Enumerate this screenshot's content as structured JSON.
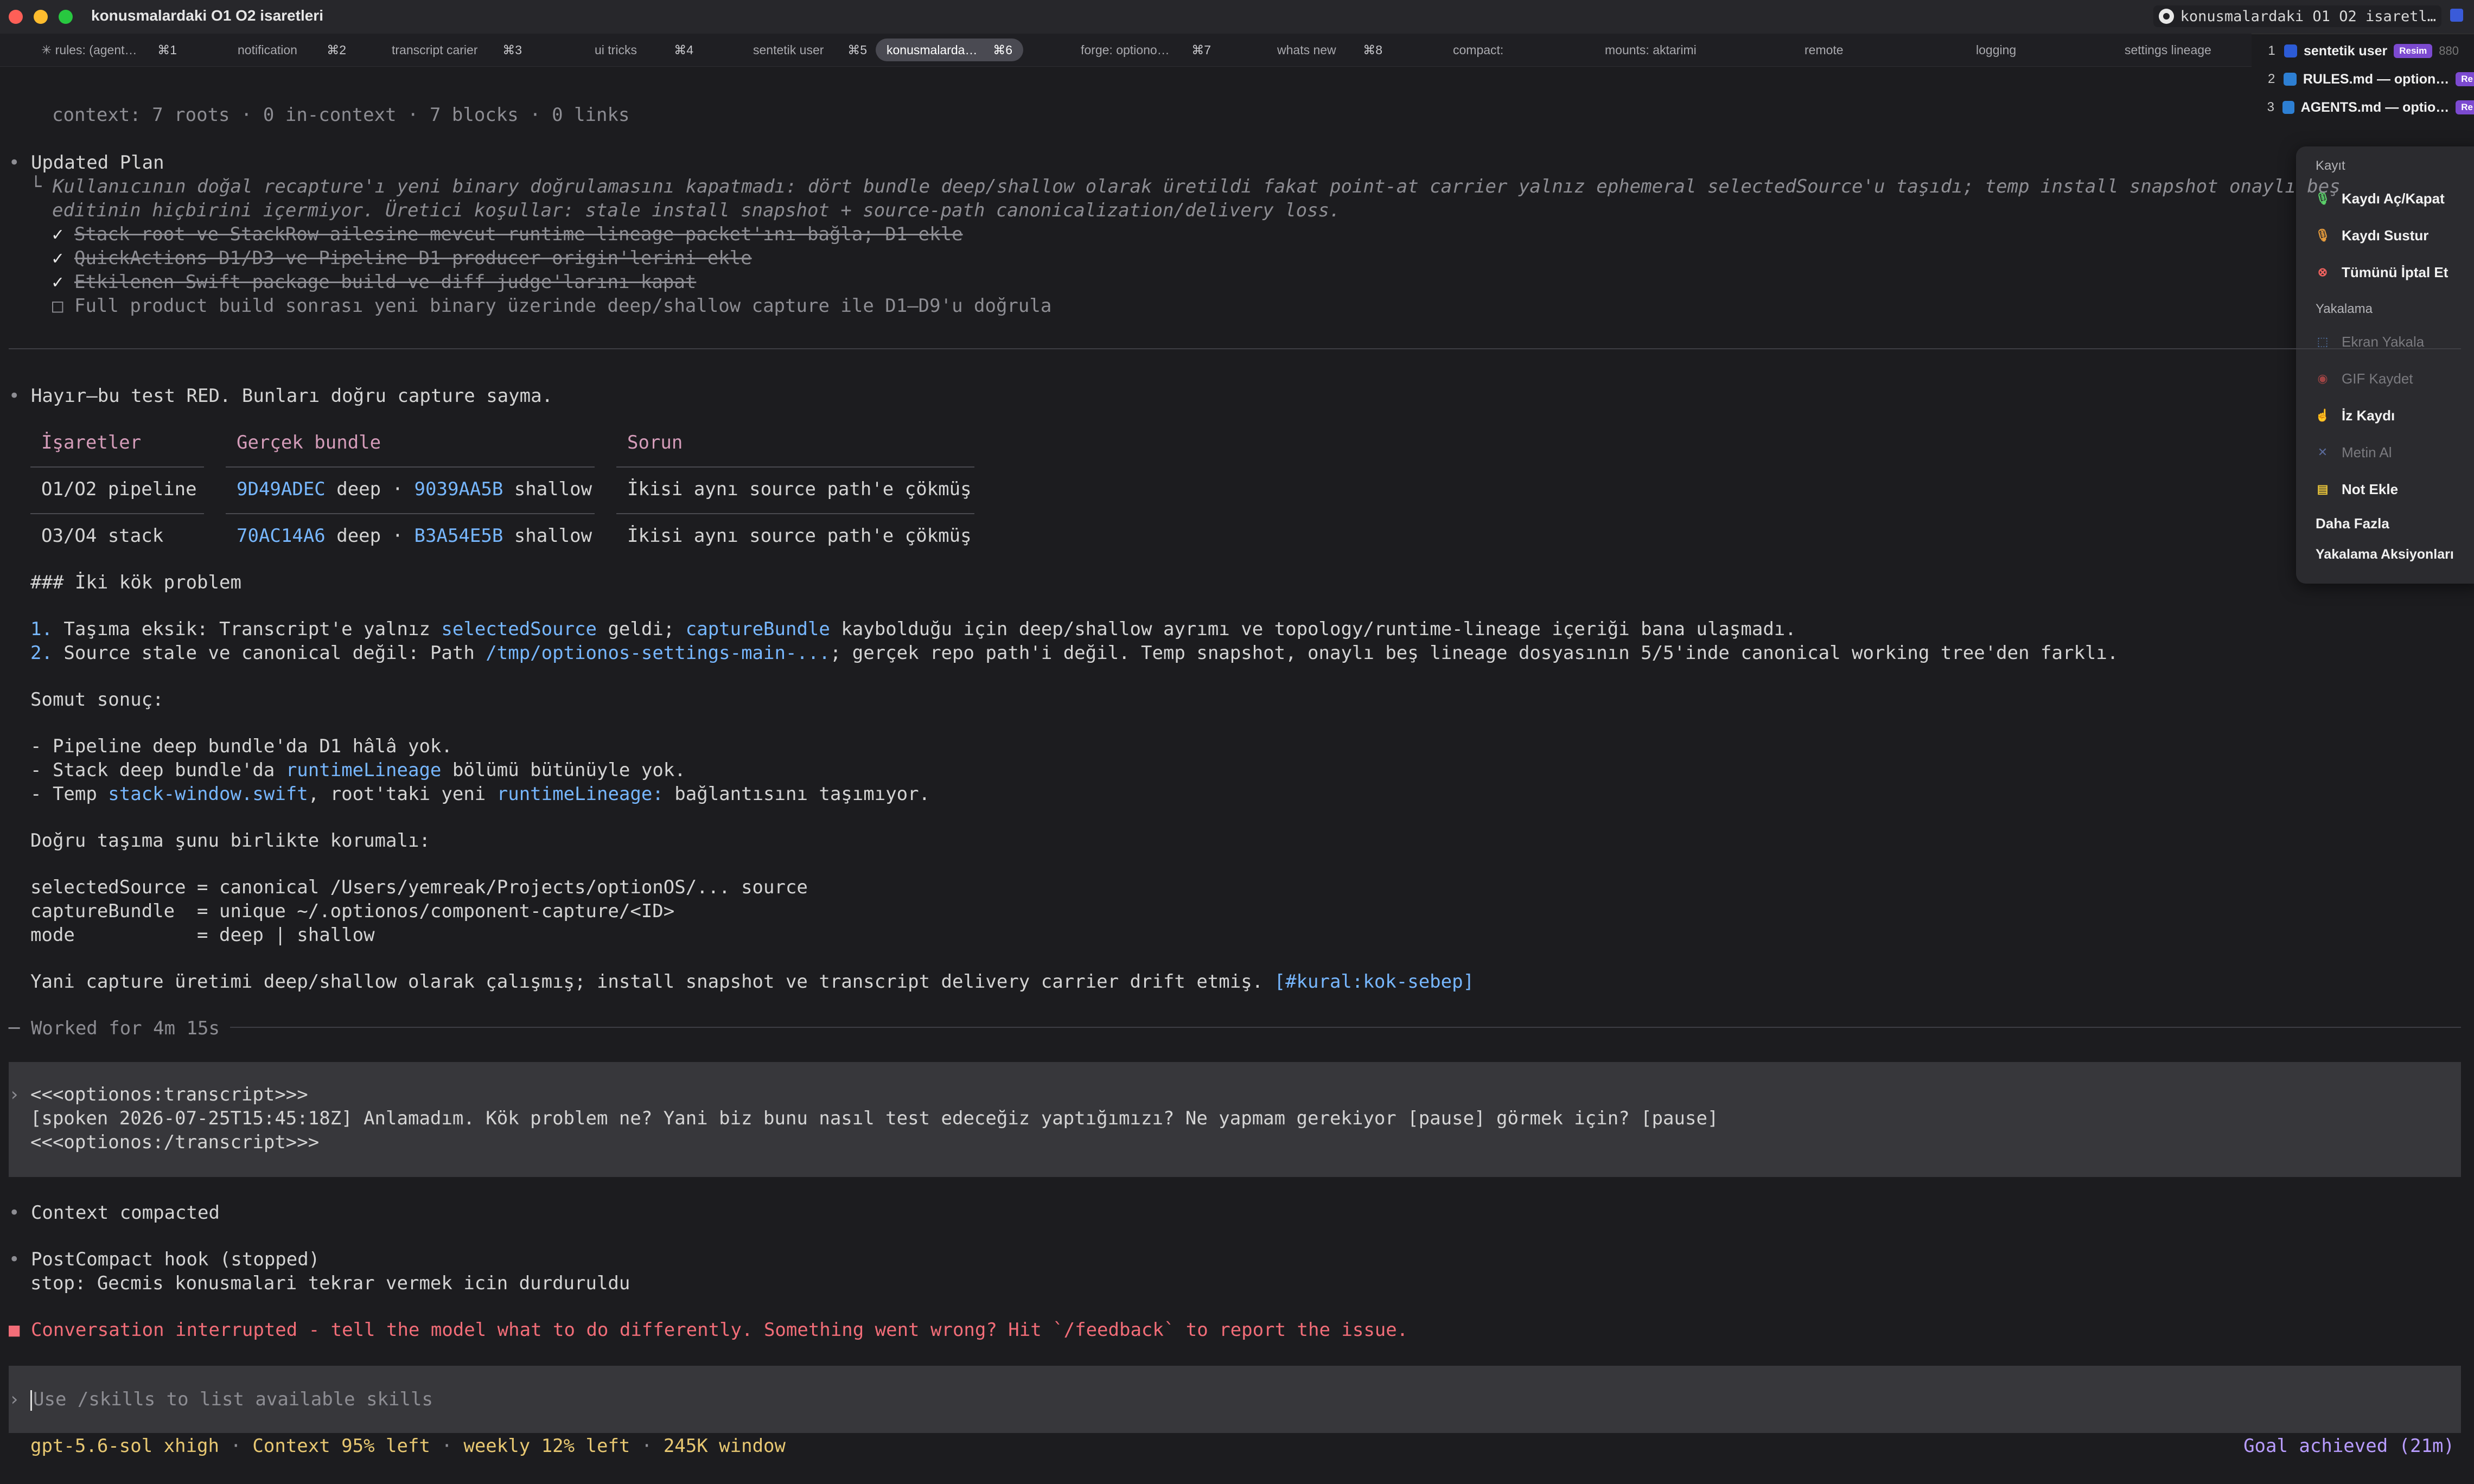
{
  "window": {
    "title": "konusmalardaki O1 O2 isaretleri",
    "right_title": "konusmalardaki O1 O2 isaretl…"
  },
  "tabs": [
    {
      "label": "✳ rules: (agent…",
      "key": "⌘1"
    },
    {
      "label": "notification",
      "key": "⌘2"
    },
    {
      "label": "transcript carier",
      "key": "⌘3"
    },
    {
      "label": "ui tricks",
      "key": "⌘4"
    },
    {
      "label": "sentetik user",
      "key": "⌘5"
    },
    {
      "label": "konusmalarda…",
      "key": "⌘6"
    },
    {
      "label": "forge: optiono…",
      "key": "⌘7"
    },
    {
      "label": "whats new",
      "key": "⌘8"
    },
    {
      "label": "compact:",
      "key": ""
    },
    {
      "label": "mounts: aktarimi",
      "key": ""
    },
    {
      "label": "remote",
      "key": ""
    },
    {
      "label": "logging",
      "key": ""
    },
    {
      "label": "settings lineage",
      "key": ""
    }
  ],
  "window_list": [
    {
      "num": "1",
      "label": "sentetik user",
      "badge": "Resim",
      "extra": "880"
    },
    {
      "num": "2",
      "label": "RULES.md — option…",
      "badge": "Re"
    },
    {
      "num": "3",
      "label": "AGENTS.md — optio…",
      "badge": "Re"
    }
  ],
  "menu": {
    "sections": [
      {
        "title": "Kayıt",
        "items": [
          {
            "label": "Kaydı Aç/Kapat",
            "icon": "mic-icon",
            "enabled": true
          },
          {
            "label": "Kaydı Sustur",
            "icon": "mic-mute-icon",
            "enabled": true
          },
          {
            "label": "Tümünü İptal Et",
            "icon": "cancel-circle-icon",
            "enabled": true
          }
        ]
      },
      {
        "title": "Yakalama",
        "items": [
          {
            "label": "Ekran Yakala",
            "icon": "screen-capture-icon",
            "enabled": false
          },
          {
            "label": "GIF Kaydet",
            "icon": "record-icon",
            "enabled": false
          },
          {
            "label": "İz Kaydı",
            "icon": "trace-icon",
            "enabled": true
          },
          {
            "label": "Metin Al",
            "icon": "text-grab-icon",
            "enabled": false
          },
          {
            "label": "Not Ekle",
            "icon": "note-icon",
            "enabled": true
          }
        ]
      }
    ],
    "more": "Daha Fazla",
    "more_item": "Yakalama Aksiyonları"
  },
  "transcript": {
    "context": "context: 7 roots · 0 in-context · 7 blocks · 0 links",
    "plan_title": "Updated Plan",
    "plan_note_1": "Kullanıcının doğal recapture'ı yeni binary doğrulamasını kapatmadı: dört bundle deep/shallow olarak üretildi fakat point-at carrier yalnız ephemeral selectedSource'u taşıdı; temp install snapshot onaylı beş",
    "plan_note_2": "editinin hiçbirini içermiyor. Üretici koşullar: stale install snapshot + source-path canonicalization/delivery loss.",
    "plan_items": [
      {
        "mark": "✓",
        "text": "Stack root ve StackRow ailesine mevcut runtime lineage packet'ını bağla; D1 ekle",
        "done": true
      },
      {
        "mark": "✓",
        "text": "QuickActions D1/D3 ve Pipeline D1 producer origin'lerini ekle",
        "done": true
      },
      {
        "mark": "✓",
        "text": "Etkilenen Swift package build ve diff judge'larını kapat",
        "done": true
      },
      {
        "mark": "□",
        "text": "Full product build sonrası yeni binary üzerinde deep/shallow capture ile D1–D9'u doğrula",
        "done": false
      }
    ],
    "verdict": "Hayır—bu test RED. Bunları doğru capture sayma.",
    "table": {
      "headers": [
        "İşaretler",
        "Gerçek bundle",
        "Sorun"
      ],
      "rows": [
        {
          "marks": "O1/O2 pipeline",
          "id1": "9D49ADEC",
          "t1": " deep · ",
          "id2": "9039AA5B",
          "t2": " shallow",
          "issue": "İkisi aynı source path'e çökmüş"
        },
        {
          "marks": "O3/O4 stack",
          "id1": "70AC14A6",
          "t1": " deep · ",
          "id2": "B3A54E5B",
          "t2": " shallow",
          "issue": "İkisi aynı source path'e çökmüş"
        }
      ]
    },
    "heading": "### İki kök problem",
    "problems": [
      {
        "num": "1.",
        "pre": " Taşıma eksik: Transcript'e yalnız ",
        "h1": "selectedSource",
        "mid": " geldi; ",
        "h2": "captureBundle",
        "post": " kaybolduğu için deep/shallow ayrımı ve topology/runtime-lineage içeriği bana ulaşmadı."
      },
      {
        "num": "2.",
        "pre": " Source stale ve canonical değil: Path ",
        "h1": "/tmp/optionos-settings-main-...",
        "post": "; gerçek repo path'i değil. Temp snapshot, onaylı beş lineage dosyasının 5/5'inde canonical working tree'den farklı."
      }
    ],
    "concrete_title": "Somut sonuç:",
    "concrete": [
      {
        "pre": "- Pipeline deep bundle'da D1 hâlâ yok.",
        "h": "",
        "post": ""
      },
      {
        "pre": "- Stack deep bundle'da ",
        "h": "runtimeLineage",
        "post": " bölümü bütünüyle yok."
      },
      {
        "pre": "- Temp ",
        "h": "stack-window.swift",
        "mid": ", root'taki yeni ",
        "h2": "runtimeLineage:",
        "post": " bağlantısını taşımıyor."
      }
    ],
    "protect_title": "Doğru taşıma şunu birlikte korumalı:",
    "code": [
      "selectedSource = canonical /Users/yemreak/Projects/optionOS/... source",
      "captureBundle  = unique ~/.optionos/component-capture/<ID>",
      "mode           = deep | shallow"
    ],
    "summary": "Yani capture üretimi deep/shallow olarak çalışmış; install snapshot ve transcript delivery carrier drift etmiş. ",
    "summary_tag": "[#kural:kok-sebep]",
    "worked": "Worked for 4m 15s",
    "user_block": [
      "<<<optionos:transcript>>>",
      "[spoken 2026-07-25T15:45:18Z] Anlamadım. Kök problem ne? Yani biz bunu nasıl test edeceğiz yaptığımızı? Ne yapmam gerekiyor [pause] görmek için? [pause]",
      "<<<optionos:/transcript>>>"
    ],
    "compacted": "Context compacted",
    "hook_title": "PostCompact hook (stopped)",
    "hook_stop": "stop: Gecmis konusmalari tekrar vermek icin durduruldu",
    "interrupted": "Conversation interrupted - tell the model what to do differently. Something went wrong? Hit `/feedback` to report the issue."
  },
  "input": {
    "placeholder": "Use /skills to list available skills"
  },
  "status": {
    "model": "gpt-5.6-sol xhigh",
    "context_left": "Context 95% left",
    "weekly": "weekly 12% left",
    "window": "245K window",
    "goal": "Goal achieved (21m)"
  }
}
